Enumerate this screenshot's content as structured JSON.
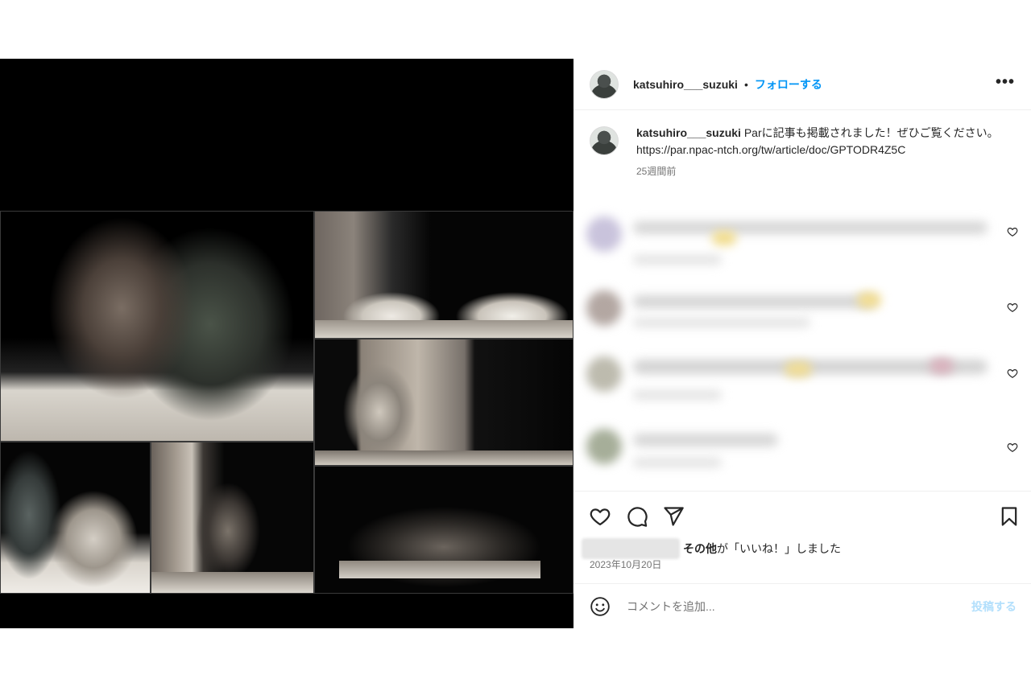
{
  "post": {
    "username": "katsuhiro___suzuki",
    "separator": "•",
    "follow_label": "フォローする",
    "more_label": "•••"
  },
  "caption": {
    "username": "katsuhiro___suzuki",
    "text": " Parに記事も掲載されました！ぜひご覧ください。",
    "link": "https://par.npac-ntch.org/tw/article/doc/GPTODR4Z5C",
    "time": "25週間前"
  },
  "likes": {
    "others": "その他",
    "suffix": "が「いいね！」しました"
  },
  "date": "2023年10月20日",
  "comment_box": {
    "placeholder": "コメントを追加...",
    "post_label": "投稿する"
  },
  "colors": {
    "accent": "#0095f6",
    "post_disabled": "#b2dffc",
    "text": "#262626",
    "muted": "#737373"
  },
  "icons": [
    "heart-icon",
    "comment-icon",
    "share-icon",
    "bookmark-icon",
    "smile-icon",
    "more-icon"
  ]
}
